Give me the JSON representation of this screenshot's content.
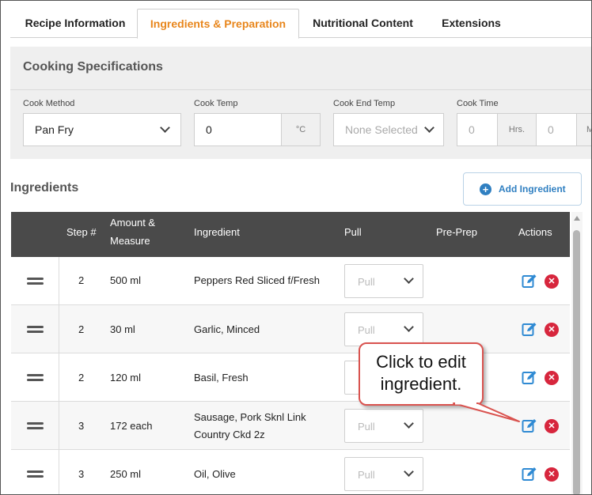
{
  "tabs": [
    {
      "label": "Recipe Information"
    },
    {
      "label": "Ingredients & Preparation"
    },
    {
      "label": "Nutritional Content"
    },
    {
      "label": "Extensions"
    }
  ],
  "active_tab": "Ingredients & Preparation",
  "accent_color": "#e8861c",
  "cooking_specs": {
    "title": "Cooking Specifications",
    "cook_method": {
      "label": "Cook Method",
      "value": "Pan Fry"
    },
    "cook_temp": {
      "label": "Cook Temp",
      "value": "0",
      "unit": "°C"
    },
    "cook_end_temp": {
      "label": "Cook End Temp",
      "placeholder": "None Selected"
    },
    "cook_time": {
      "label": "Cook Time",
      "hours": "0",
      "hours_unit": "Hrs.",
      "minutes": "0",
      "minutes_unit": "M"
    }
  },
  "ingredients": {
    "title": "Ingredients",
    "add_button": "Add Ingredient",
    "columns": {
      "step": "Step #",
      "amount_line1": "Amount &",
      "amount_line2": "Measure",
      "ingredient": "Ingredient",
      "pull": "Pull",
      "preprep": "Pre-Prep",
      "actions": "Actions"
    },
    "pull_placeholder": "Pull",
    "rows": [
      {
        "step": "2",
        "amount": "500 ml",
        "ingredient_line1": "Peppers Red Sliced f/Fresh",
        "ingredient_line2": ""
      },
      {
        "step": "2",
        "amount": "30 ml",
        "ingredient_line1": "Garlic, Minced",
        "ingredient_line2": ""
      },
      {
        "step": "2",
        "amount": "120 ml",
        "ingredient_line1": "Basil, Fresh",
        "ingredient_line2": ""
      },
      {
        "step": "3",
        "amount": "172 each",
        "ingredient_line1": "Sausage, Pork Sknl Link",
        "ingredient_line2": "Country Ckd 2z"
      },
      {
        "step": "3",
        "amount": "250 ml",
        "ingredient_line1": "Oil, Olive",
        "ingredient_line2": ""
      }
    ]
  },
  "callout": {
    "line1": "Click to edit",
    "line2": "ingredient."
  },
  "icons": {
    "add": "plus-circle-icon",
    "edit": "edit-icon",
    "delete": "delete-icon",
    "drag": "drag-handle-icon",
    "dropdown": "chevron-down-icon"
  }
}
